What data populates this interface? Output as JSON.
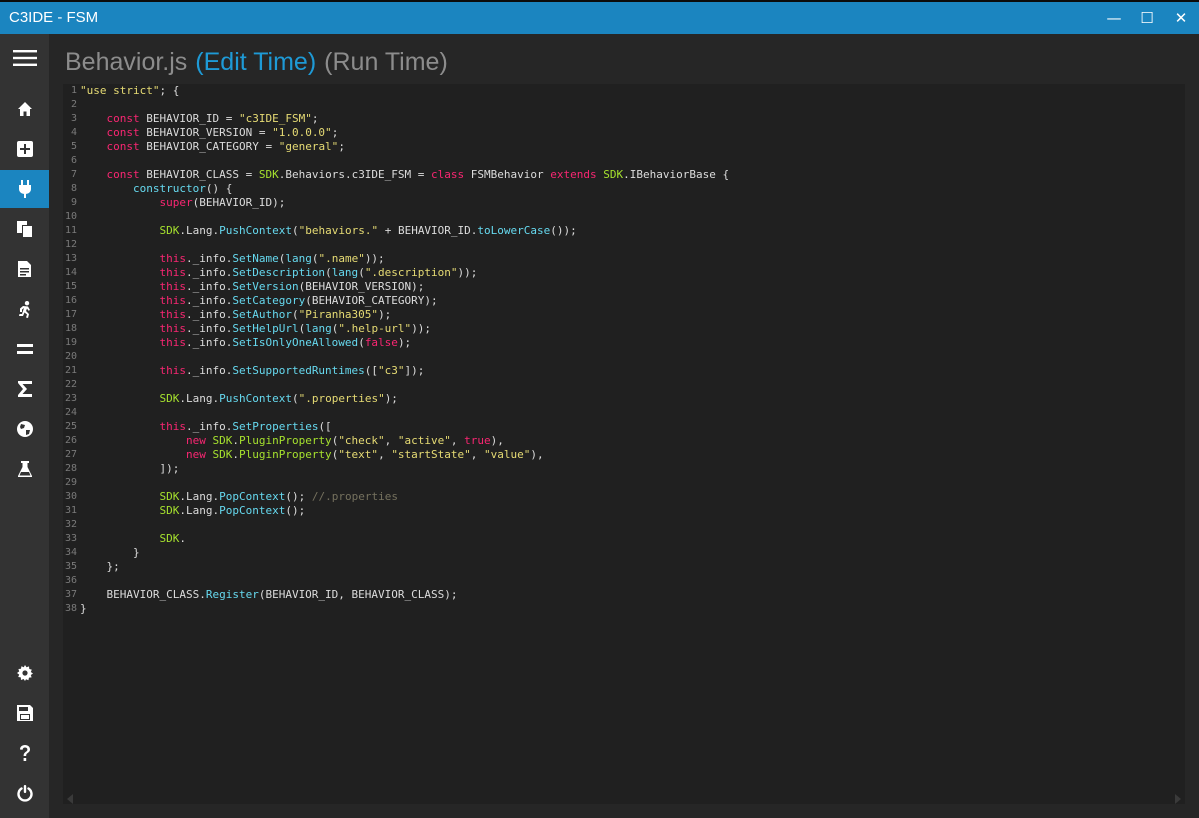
{
  "window": {
    "title": "C3IDE - FSM",
    "controls": [
      {
        "name": "minimize-button",
        "glyph": "—",
        "icon": "minimize-icon"
      },
      {
        "name": "maximize-button",
        "glyph": "☐",
        "icon": "maximize-icon"
      },
      {
        "name": "close-button",
        "glyph": "✕",
        "icon": "close-icon"
      }
    ]
  },
  "sidebar": {
    "accent": "#1b85c0",
    "top_items": [
      {
        "name": "menu",
        "icon": "hamburger-icon",
        "active": false
      },
      {
        "name": "home",
        "icon": "home-icon",
        "active": false
      },
      {
        "name": "new",
        "icon": "add-icon",
        "active": false
      },
      {
        "name": "behavior",
        "icon": "plug-icon",
        "active": true
      },
      {
        "name": "copy",
        "icon": "copy-icon",
        "active": false
      },
      {
        "name": "document",
        "icon": "document-icon",
        "active": false
      },
      {
        "name": "actions",
        "icon": "run-icon",
        "active": false
      },
      {
        "name": "equals",
        "icon": "equals-icon",
        "active": false
      },
      {
        "name": "expressions",
        "icon": "sigma-icon",
        "active": false
      },
      {
        "name": "language",
        "icon": "globe-icon",
        "active": false
      },
      {
        "name": "test",
        "icon": "flask-icon",
        "active": false
      }
    ],
    "bottom_items": [
      {
        "name": "settings",
        "icon": "gear-icon"
      },
      {
        "name": "save",
        "icon": "save-icon"
      },
      {
        "name": "help",
        "icon": "help-icon"
      },
      {
        "name": "power",
        "icon": "power-icon"
      }
    ]
  },
  "header": {
    "file": "Behavior.js",
    "edit_time": "(Edit Time)",
    "run_time": "(Run Time)"
  },
  "code": [
    [
      [
        "s",
        "\"use strict\""
      ],
      [
        "p",
        "; {"
      ]
    ],
    [],
    [
      [
        "p",
        "    "
      ],
      [
        "k",
        "const"
      ],
      [
        "p",
        " BEHAVIOR_ID = "
      ],
      [
        "s",
        "\"c3IDE_FSM\""
      ],
      [
        "p",
        ";"
      ]
    ],
    [
      [
        "p",
        "    "
      ],
      [
        "k",
        "const"
      ],
      [
        "p",
        " BEHAVIOR_VERSION = "
      ],
      [
        "s",
        "\"1.0.0.0\""
      ],
      [
        "p",
        ";"
      ]
    ],
    [
      [
        "p",
        "    "
      ],
      [
        "k",
        "const"
      ],
      [
        "p",
        " BEHAVIOR_CATEGORY = "
      ],
      [
        "s",
        "\"general\""
      ],
      [
        "p",
        ";"
      ]
    ],
    [],
    [
      [
        "p",
        "    "
      ],
      [
        "k",
        "const"
      ],
      [
        "p",
        " BEHAVIOR_CLASS = "
      ],
      [
        "d",
        "SDK"
      ],
      [
        "p",
        ".Behaviors.c3IDE_FSM = "
      ],
      [
        "k",
        "class"
      ],
      [
        "p",
        " FSMBehavior "
      ],
      [
        "k",
        "extends"
      ],
      [
        "p",
        " "
      ],
      [
        "d",
        "SDK"
      ],
      [
        "p",
        ".IBehaviorBase {"
      ]
    ],
    [
      [
        "p",
        "        "
      ],
      [
        "f",
        "constructor"
      ],
      [
        "p",
        "() {"
      ]
    ],
    [
      [
        "p",
        "            "
      ],
      [
        "k",
        "super"
      ],
      [
        "p",
        "(BEHAVIOR_ID);"
      ]
    ],
    [],
    [
      [
        "p",
        "            "
      ],
      [
        "d",
        "SDK"
      ],
      [
        "p",
        ".Lang."
      ],
      [
        "f",
        "PushContext"
      ],
      [
        "p",
        "("
      ],
      [
        "s",
        "\"behaviors.\""
      ],
      [
        "p",
        " + BEHAVIOR_ID."
      ],
      [
        "f",
        "toLowerCase"
      ],
      [
        "p",
        "());"
      ]
    ],
    [],
    [
      [
        "p",
        "            "
      ],
      [
        "k",
        "this"
      ],
      [
        "p",
        "._info."
      ],
      [
        "f",
        "SetName"
      ],
      [
        "p",
        "("
      ],
      [
        "f",
        "lang"
      ],
      [
        "p",
        "("
      ],
      [
        "s",
        "\".name\""
      ],
      [
        "p",
        "));"
      ]
    ],
    [
      [
        "p",
        "            "
      ],
      [
        "k",
        "this"
      ],
      [
        "p",
        "._info."
      ],
      [
        "f",
        "SetDescription"
      ],
      [
        "p",
        "("
      ],
      [
        "f",
        "lang"
      ],
      [
        "p",
        "("
      ],
      [
        "s",
        "\".description\""
      ],
      [
        "p",
        "));"
      ]
    ],
    [
      [
        "p",
        "            "
      ],
      [
        "k",
        "this"
      ],
      [
        "p",
        "._info."
      ],
      [
        "f",
        "SetVersion"
      ],
      [
        "p",
        "(BEHAVIOR_VERSION);"
      ]
    ],
    [
      [
        "p",
        "            "
      ],
      [
        "k",
        "this"
      ],
      [
        "p",
        "._info."
      ],
      [
        "f",
        "SetCategory"
      ],
      [
        "p",
        "(BEHAVIOR_CATEGORY);"
      ]
    ],
    [
      [
        "p",
        "            "
      ],
      [
        "k",
        "this"
      ],
      [
        "p",
        "._info."
      ],
      [
        "f",
        "SetAuthor"
      ],
      [
        "p",
        "("
      ],
      [
        "s",
        "\"Piranha305\""
      ],
      [
        "p",
        ");"
      ]
    ],
    [
      [
        "p",
        "            "
      ],
      [
        "k",
        "this"
      ],
      [
        "p",
        "._info."
      ],
      [
        "f",
        "SetHelpUrl"
      ],
      [
        "p",
        "("
      ],
      [
        "f",
        "lang"
      ],
      [
        "p",
        "("
      ],
      [
        "s",
        "\".help-url\""
      ],
      [
        "p",
        "));"
      ]
    ],
    [
      [
        "p",
        "            "
      ],
      [
        "k",
        "this"
      ],
      [
        "p",
        "._info."
      ],
      [
        "f",
        "SetIsOnlyOneAllowed"
      ],
      [
        "p",
        "("
      ],
      [
        "k",
        "false"
      ],
      [
        "p",
        ");"
      ]
    ],
    [],
    [
      [
        "p",
        "            "
      ],
      [
        "k",
        "this"
      ],
      [
        "p",
        "._info."
      ],
      [
        "f",
        "SetSupportedRuntimes"
      ],
      [
        "p",
        "(["
      ],
      [
        "s",
        "\"c3\""
      ],
      [
        "p",
        "]);"
      ]
    ],
    [],
    [
      [
        "p",
        "            "
      ],
      [
        "d",
        "SDK"
      ],
      [
        "p",
        ".Lang."
      ],
      [
        "f",
        "PushContext"
      ],
      [
        "p",
        "("
      ],
      [
        "s",
        "\".properties\""
      ],
      [
        "p",
        ");"
      ]
    ],
    [],
    [
      [
        "p",
        "            "
      ],
      [
        "k",
        "this"
      ],
      [
        "p",
        "._info."
      ],
      [
        "f",
        "SetProperties"
      ],
      [
        "p",
        "(["
      ]
    ],
    [
      [
        "p",
        "                "
      ],
      [
        "k",
        "new"
      ],
      [
        "p",
        " "
      ],
      [
        "d",
        "SDK"
      ],
      [
        "p",
        "."
      ],
      [
        "d",
        "PluginProperty"
      ],
      [
        "p",
        "("
      ],
      [
        "s",
        "\"check\""
      ],
      [
        "p",
        ", "
      ],
      [
        "s",
        "\"active\""
      ],
      [
        "p",
        ", "
      ],
      [
        "k",
        "true"
      ],
      [
        "p",
        "),"
      ]
    ],
    [
      [
        "p",
        "                "
      ],
      [
        "k",
        "new"
      ],
      [
        "p",
        " "
      ],
      [
        "d",
        "SDK"
      ],
      [
        "p",
        "."
      ],
      [
        "d",
        "PluginProperty"
      ],
      [
        "p",
        "("
      ],
      [
        "s",
        "\"text\""
      ],
      [
        "p",
        ", "
      ],
      [
        "s",
        "\"startState\""
      ],
      [
        "p",
        ", "
      ],
      [
        "s",
        "\"value\""
      ],
      [
        "p",
        "),"
      ]
    ],
    [
      [
        "p",
        "            ]);"
      ]
    ],
    [],
    [
      [
        "p",
        "            "
      ],
      [
        "d",
        "SDK"
      ],
      [
        "p",
        ".Lang."
      ],
      [
        "f",
        "PopContext"
      ],
      [
        "p",
        "(); "
      ],
      [
        "c",
        "//.properties"
      ]
    ],
    [
      [
        "p",
        "            "
      ],
      [
        "d",
        "SDK"
      ],
      [
        "p",
        ".Lang."
      ],
      [
        "f",
        "PopContext"
      ],
      [
        "p",
        "();"
      ]
    ],
    [],
    [
      [
        "p",
        "            "
      ],
      [
        "d",
        "SDK"
      ],
      [
        "p",
        "."
      ]
    ],
    [
      [
        "p",
        "        }"
      ]
    ],
    [
      [
        "p",
        "    };"
      ]
    ],
    [],
    [
      [
        "p",
        "    BEHAVIOR_CLASS."
      ],
      [
        "f",
        "Register"
      ],
      [
        "p",
        "(BEHAVIOR_ID, BEHAVIOR_CLASS);"
      ]
    ],
    [
      [
        "p",
        "}"
      ]
    ]
  ]
}
